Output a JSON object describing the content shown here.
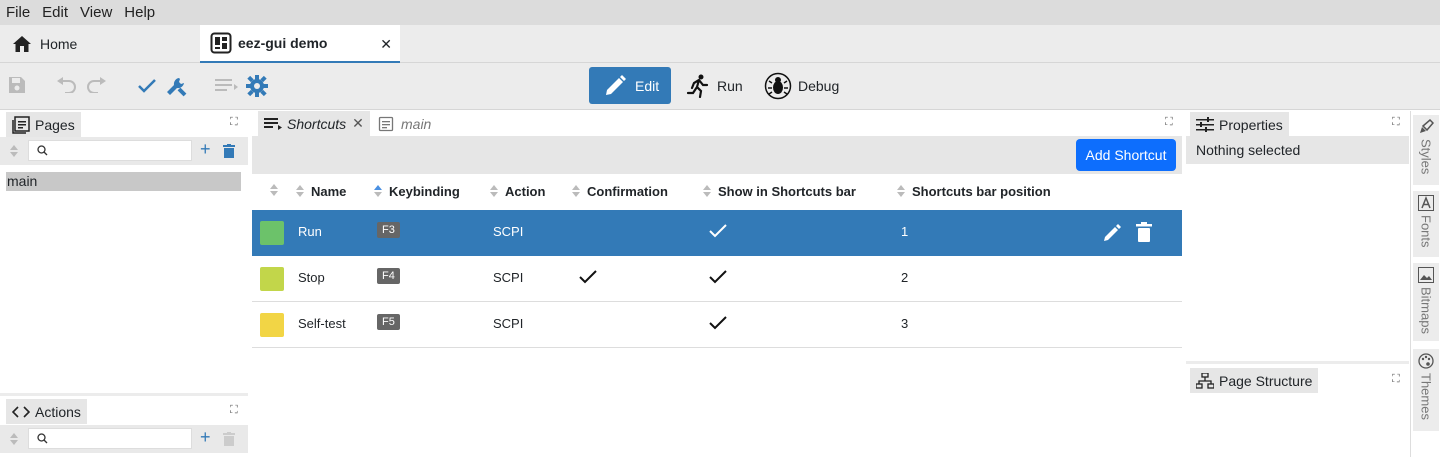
{
  "menu": {
    "file": "File",
    "edit": "Edit",
    "view": "View",
    "help": "Help"
  },
  "tabs": {
    "home": "Home",
    "project": "eez-gui demo"
  },
  "modes": {
    "edit": "Edit",
    "run": "Run",
    "debug": "Debug"
  },
  "pages_panel": {
    "title": "Pages",
    "items": [
      "main"
    ]
  },
  "actions_panel": {
    "title": "Actions"
  },
  "editor_tabs": {
    "shortcuts": "Shortcuts",
    "main": "main"
  },
  "shortcuts": {
    "add_label": "Add Shortcut",
    "columns": [
      "Name",
      "Keybinding",
      "Action",
      "Confirmation",
      "Show in Shortcuts bar",
      "Shortcuts bar position"
    ],
    "rows": [
      {
        "color": "#6cc26a",
        "name": "Run",
        "key": "F3",
        "action": "SCPI",
        "confirmation": false,
        "show": true,
        "position": "1"
      },
      {
        "color": "#c2d64a",
        "name": "Stop",
        "key": "F4",
        "action": "SCPI",
        "confirmation": true,
        "show": true,
        "position": "2"
      },
      {
        "color": "#f2d545",
        "name": "Self-test",
        "key": "F5",
        "action": "SCPI",
        "confirmation": false,
        "show": true,
        "position": "3"
      }
    ]
  },
  "properties_panel": {
    "title": "Properties",
    "empty": "Nothing selected"
  },
  "page_structure_panel": {
    "title": "Page Structure"
  },
  "sidebar": {
    "styles": "Styles",
    "fonts": "Fonts",
    "bitmaps": "Bitmaps",
    "themes": "Themes"
  },
  "colors": {
    "accent": "#337ab7",
    "primary_button": "#0d6efd"
  }
}
